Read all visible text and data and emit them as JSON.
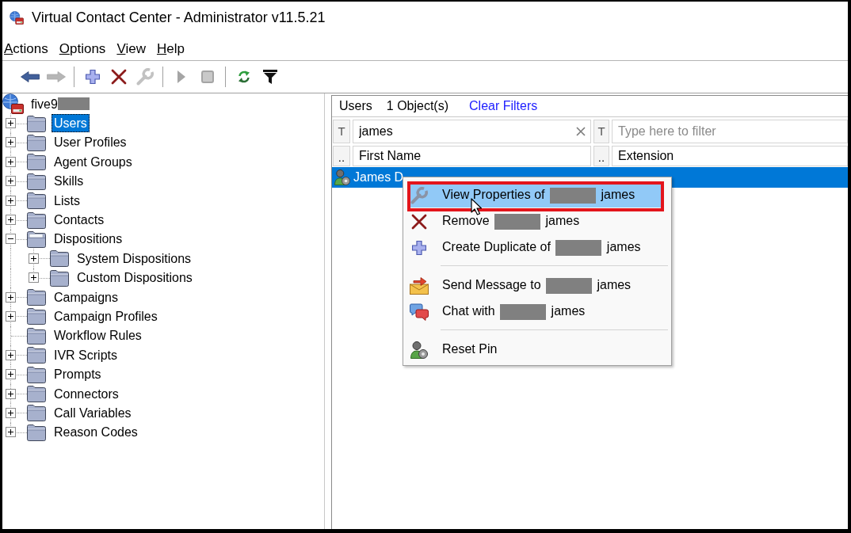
{
  "window": {
    "title": "Virtual Contact Center - Administrator v11.5.21"
  },
  "menu_bar": [
    {
      "label": "Actions"
    },
    {
      "label": "Options"
    },
    {
      "label": "View"
    },
    {
      "label": "Help"
    }
  ],
  "toolbar": [
    {
      "kind": "button",
      "disabled": false
    },
    {
      "kind": "button",
      "disabled": true
    },
    {
      "kind": "separator"
    },
    {
      "kind": "button",
      "disabled": false
    },
    {
      "kind": "button",
      "disabled": false
    },
    {
      "kind": "button",
      "disabled": true
    },
    {
      "kind": "separator"
    },
    {
      "kind": "button",
      "disabled": true
    },
    {
      "kind": "button",
      "disabled": true
    },
    {
      "kind": "separator"
    },
    {
      "kind": "button",
      "disabled": false
    },
    {
      "kind": "button",
      "disabled": false
    }
  ],
  "tree": {
    "root": {
      "label": "five9",
      "redacted": true
    },
    "items": [
      {
        "label": "Users",
        "selected": true,
        "expandable": true,
        "expanded": false
      },
      {
        "label": "User Profiles",
        "selected": false,
        "expandable": true,
        "expanded": false
      },
      {
        "label": "Agent Groups",
        "selected": false,
        "expandable": true,
        "expanded": false
      },
      {
        "label": "Skills",
        "selected": false,
        "expandable": true,
        "expanded": false
      },
      {
        "label": "Lists",
        "selected": false,
        "expandable": true,
        "expanded": false
      },
      {
        "label": "Contacts",
        "selected": false,
        "expandable": true,
        "expanded": false
      },
      {
        "label": "Dispositions",
        "selected": false,
        "expandable": true,
        "expanded": true,
        "children": [
          {
            "label": "System Dispositions",
            "selected": false,
            "expandable": true,
            "expanded": false
          },
          {
            "label": "Custom Dispositions",
            "selected": false,
            "expandable": true,
            "expanded": false
          }
        ]
      },
      {
        "label": "Campaigns",
        "selected": false,
        "expandable": true,
        "expanded": false
      },
      {
        "label": "Campaign Profiles",
        "selected": false,
        "expandable": true,
        "expanded": false
      },
      {
        "label": "Workflow Rules",
        "selected": false,
        "expandable": false,
        "expanded": false
      },
      {
        "label": "IVR Scripts",
        "selected": false,
        "expandable": true,
        "expanded": false
      },
      {
        "label": "Prompts",
        "selected": false,
        "expandable": true,
        "expanded": false
      },
      {
        "label": "Connectors",
        "selected": false,
        "expandable": true,
        "expanded": false
      },
      {
        "label": "Call Variables",
        "selected": false,
        "expandable": true,
        "expanded": false
      },
      {
        "label": "Reason Codes",
        "selected": false,
        "expandable": true,
        "expanded": false
      }
    ]
  },
  "list_view": {
    "title": "Users",
    "count": "1 Object(s)",
    "clear_filters": "Clear Filters",
    "columns": [
      {
        "filter_button": "T",
        "filter": {
          "value": "james"
        },
        "menu_button": "..",
        "heading": "First Name"
      },
      {
        "filter_button": "T",
        "filter": {
          "placeholder": "Type here to filter"
        },
        "menu_button": "..",
        "heading": "Extension"
      }
    ],
    "rows": [
      {
        "selected": true,
        "cells": [
          "James D"
        ]
      }
    ]
  },
  "context_menu": {
    "items": [
      {
        "kind": "item",
        "label": "View Properties of",
        "redacted": true,
        "label_after": "james",
        "selected": true,
        "outlined": true
      },
      {
        "kind": "item",
        "label": "Remove",
        "redacted": true,
        "label_after": "james",
        "selected": false,
        "outlined": false
      },
      {
        "kind": "item",
        "label": "Create Duplicate of",
        "redacted": true,
        "label_after": "james",
        "selected": false,
        "outlined": false
      },
      {
        "kind": "separator"
      },
      {
        "kind": "item",
        "label": "Send Message to",
        "redacted": true,
        "label_after": "james",
        "selected": false,
        "outlined": false
      },
      {
        "kind": "item",
        "label": "Chat with",
        "redacted": true,
        "label_after": "james",
        "selected": false,
        "outlined": false
      },
      {
        "kind": "separator"
      },
      {
        "kind": "item",
        "label": "Reset Pin",
        "redacted": false,
        "selected": false,
        "outlined": false
      }
    ]
  }
}
